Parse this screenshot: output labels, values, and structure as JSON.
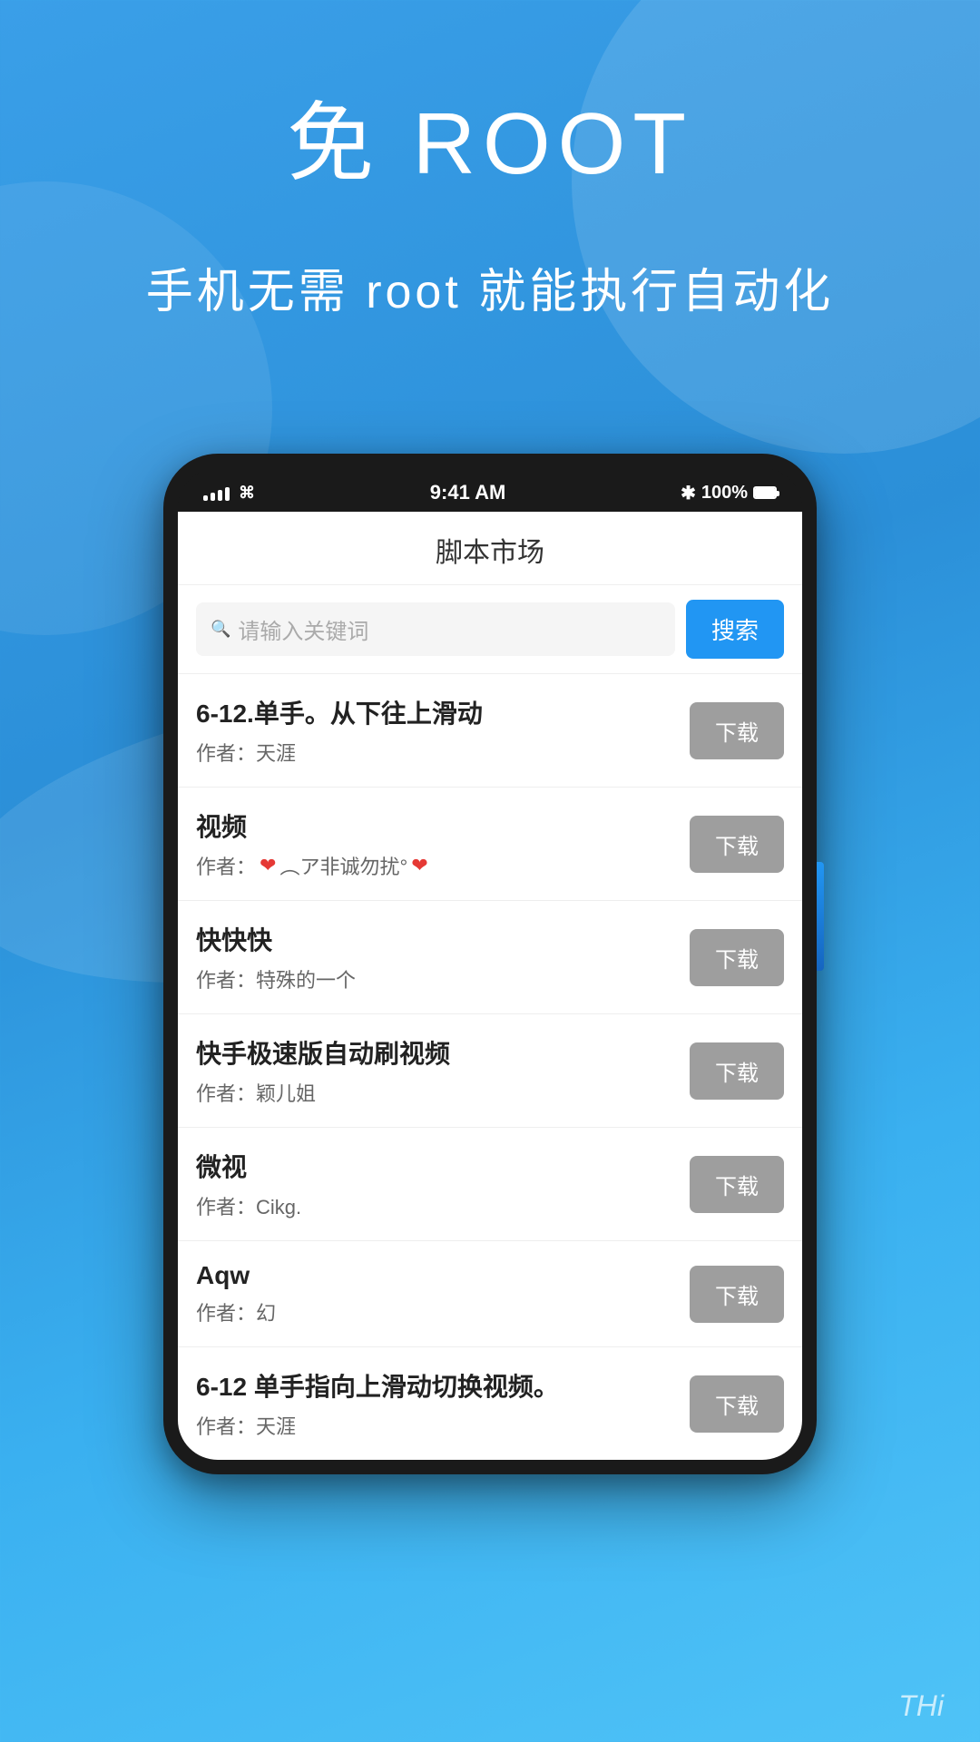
{
  "background": {
    "gradient_start": "#3a9fe8",
    "gradient_end": "#4fc3f7"
  },
  "hero": {
    "main_title": "免 ROOT",
    "subtitle": "手机无需 root 就能执行自动化"
  },
  "phone": {
    "status_bar": {
      "time": "9:41 AM",
      "battery": "100%",
      "bluetooth": "✱"
    },
    "app_title": "脚本市场",
    "search": {
      "placeholder": "请输入关键词",
      "button_label": "搜索"
    },
    "scripts": [
      {
        "name": "6-12.单手。从下往上滑动",
        "author": "作者：天涯",
        "download_label": "下载"
      },
      {
        "name": "视频",
        "author_prefix": "作者：",
        "author_text": "❤ ︵ア非诚勿扰°❤",
        "download_label": "下载"
      },
      {
        "name": "快快快",
        "author": "作者：特殊的一个",
        "download_label": "下载"
      },
      {
        "name": "快手极速版自动刷视频",
        "author": "作者：颖儿姐",
        "download_label": "下载"
      },
      {
        "name": "微视",
        "author": "作者：Cikg.",
        "download_label": "下载"
      },
      {
        "name": "Aqw",
        "author": "作者：幻",
        "download_label": "下载"
      },
      {
        "name": "6-12 单手指向上滑动切换视频。",
        "author": "作者：天涯",
        "download_label": "下载"
      }
    ]
  },
  "watermark": {
    "text": "THi"
  }
}
